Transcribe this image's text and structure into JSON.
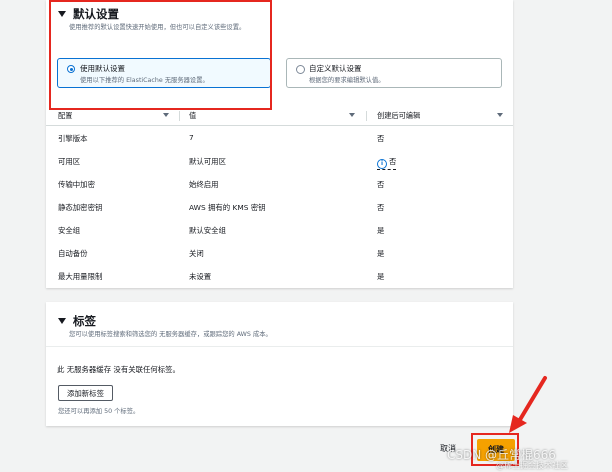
{
  "defaults": {
    "title": "默认设置",
    "description": "使用推荐的默认设置快速开始使用，但也可以自定义该些设置。",
    "options": [
      {
        "label": "使用默认设置",
        "desc": "使用以下推荐的 ElastiCache 无服务器设置。",
        "selected": true
      },
      {
        "label": "自定义默认设置",
        "desc": "根据您的要求编辑默认值。",
        "selected": false
      }
    ]
  },
  "table": {
    "headers": [
      "配置",
      "值",
      "创建后可编辑"
    ],
    "rows": [
      {
        "config": "引擎版本",
        "value": "7",
        "editable": "否"
      },
      {
        "config": "可用区",
        "value": "默认可用区",
        "editable": "否",
        "info": true
      },
      {
        "config": "传输中加密",
        "value": "始终启用",
        "editable": "否"
      },
      {
        "config": "静态加密密钥",
        "value": "AWS 拥有的 KMS 密钥",
        "editable": "否"
      },
      {
        "config": "安全组",
        "value": "默认安全组",
        "editable": "是"
      },
      {
        "config": "自动备份",
        "value": "关闭",
        "editable": "是"
      },
      {
        "config": "最大用量限制",
        "value": "未设置",
        "editable": "是"
      }
    ]
  },
  "tags": {
    "title": "标签",
    "description": "您可以使用标签搜索和筛选您的 无服务器缓存，或跟踪您的 AWS 成本。",
    "none_text": "此 无服务器缓存 没有关联任何标签。",
    "add_button": "添加新标签",
    "hint": "您还可以再添加 50 个标签。"
  },
  "footer": {
    "cancel": "取消",
    "create": "创建"
  },
  "watermark": {
    "line1": "CSDN @丘常棍666",
    "line2": "@稀土掘金技术社区"
  },
  "colors": {
    "accent": "#0972d3",
    "primary_button": "#f5a100",
    "annotation": "#e5271f"
  }
}
